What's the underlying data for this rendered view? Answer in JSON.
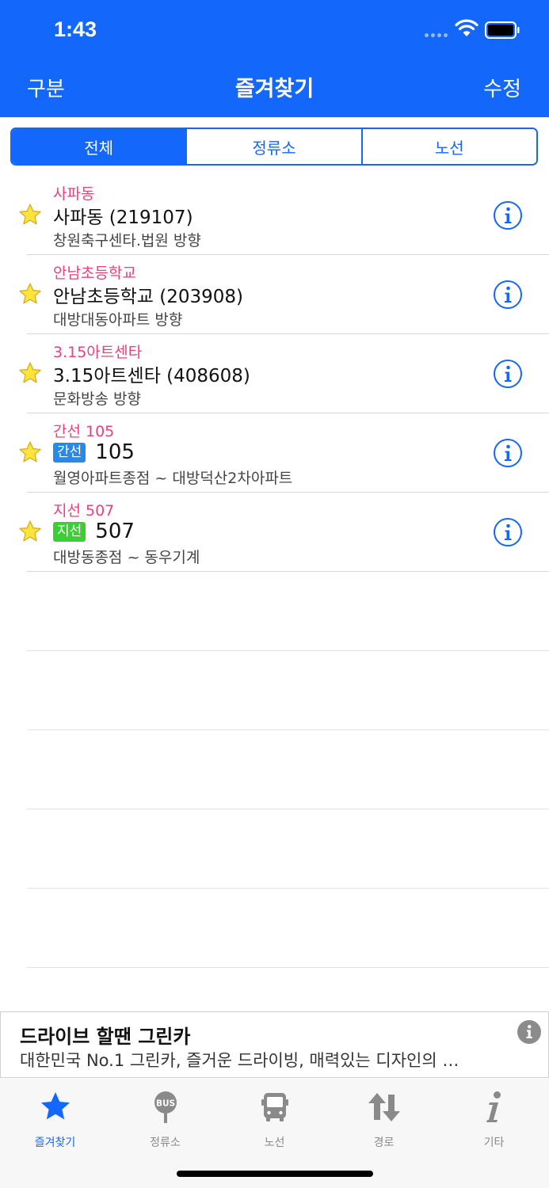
{
  "status_bar": {
    "time": "1:43"
  },
  "nav": {
    "left": "구분",
    "title": "즐겨찾기",
    "right": "수정"
  },
  "segments": [
    {
      "label": "전체",
      "active": true
    },
    {
      "label": "정류소",
      "active": false
    },
    {
      "label": "노선",
      "active": false
    }
  ],
  "favorites": [
    {
      "kind": "stop",
      "sub": "사파동",
      "main": "사파동 (219107)",
      "desc": "창원축구센타.법원 방향"
    },
    {
      "kind": "stop",
      "sub": "안남초등학교",
      "main": "안남초등학교 (203908)",
      "desc": "대방대동아파트 방향"
    },
    {
      "kind": "stop",
      "sub": "3.15아트센타",
      "main": "3.15아트센타 (408608)",
      "desc": "문화방송 방향"
    },
    {
      "kind": "route",
      "sub": "간선 105",
      "badge": "간선",
      "badge_color": "#2a89e6",
      "number": "105",
      "desc": "월영아파트종점 ~ 대방덕산2차아파트"
    },
    {
      "kind": "route",
      "sub": "지선 507",
      "badge": "지선",
      "badge_color": "#3ccf35",
      "number": "507",
      "desc": "대방동종점 ~ 동우기계"
    }
  ],
  "ad": {
    "title": "드라이브 할땐 그린카",
    "text": "대한민국 No.1 그린카, 즐거운 드라이빙, 매력있는 디자인의 …"
  },
  "tabs": [
    {
      "label": "즐겨찾기",
      "icon": "star-icon",
      "active": true
    },
    {
      "label": "정류소",
      "icon": "bus-stop-icon",
      "active": false
    },
    {
      "label": "노선",
      "icon": "bus-icon",
      "active": false
    },
    {
      "label": "경로",
      "icon": "route-arrows-icon",
      "active": false
    },
    {
      "label": "기타",
      "icon": "info-icon",
      "active": false
    }
  ],
  "colors": {
    "primary": "#1467fb",
    "subtitle_pink": "#ee3f7a",
    "star_yellow": "#fde43a",
    "tab_inactive": "#8a8a8a"
  }
}
